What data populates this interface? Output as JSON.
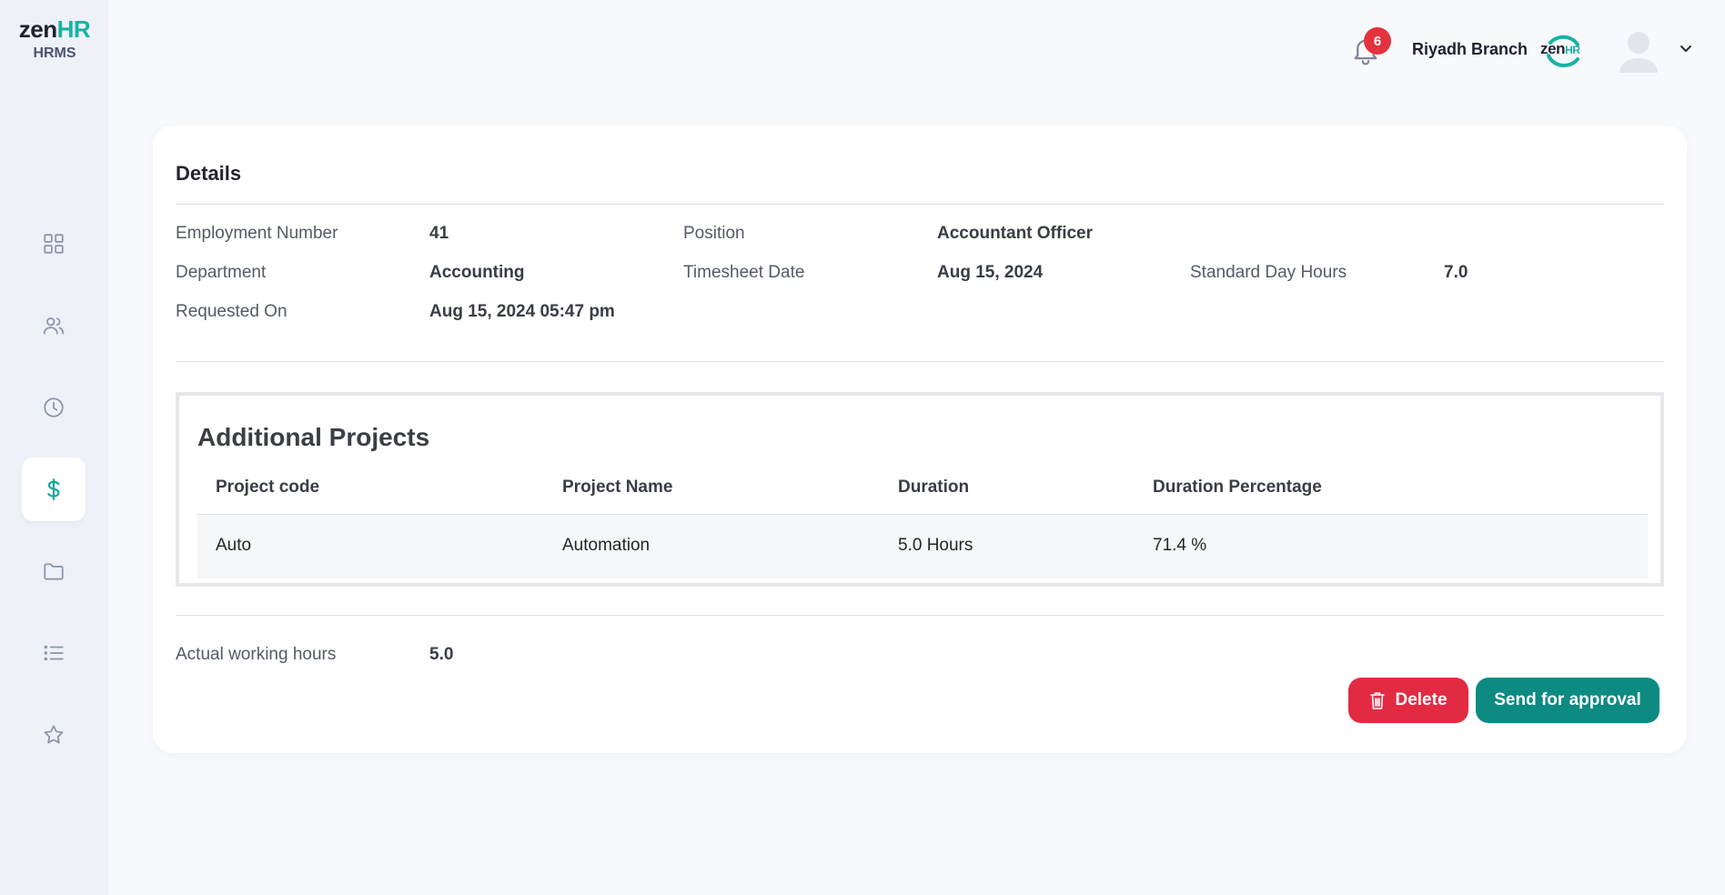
{
  "app": {
    "logo_text": "zen",
    "logo_hr": "HR",
    "logo_sub": "HRMS"
  },
  "sidebar": {
    "items": [
      {
        "icon": "grid-icon",
        "active": false
      },
      {
        "icon": "users-icon",
        "active": false
      },
      {
        "icon": "clock-icon",
        "active": false
      },
      {
        "icon": "dollar-icon",
        "active": true
      },
      {
        "icon": "folder-icon",
        "active": false
      },
      {
        "icon": "list-icon",
        "active": false
      },
      {
        "icon": "star-icon",
        "active": false
      }
    ]
  },
  "header": {
    "notification_count": "6",
    "branch_name": "Riyadh Branch",
    "company_logo_text": "zen",
    "company_logo_hr": "HR"
  },
  "details": {
    "title": "Details",
    "employment_number_label": "Employment Number",
    "employment_number_value": "41",
    "position_label": "Position",
    "position_value": "Accountant Officer",
    "department_label": "Department",
    "department_value": "Accounting",
    "timesheet_date_label": "Timesheet Date",
    "timesheet_date_value": "Aug 15, 2024",
    "standard_day_hours_label": "Standard Day Hours",
    "standard_day_hours_value": "7.0",
    "requested_on_label": "Requested On",
    "requested_on_value": "Aug 15, 2024 05:47 pm"
  },
  "projects": {
    "title": "Additional Projects",
    "columns": [
      "Project code",
      "Project Name",
      "Duration",
      "Duration Percentage"
    ],
    "rows": [
      [
        "Auto",
        "Automation",
        "5.0 Hours",
        "71.4 %"
      ]
    ]
  },
  "summary": {
    "actual_hours_label": "Actual working hours",
    "actual_hours_value": "5.0"
  },
  "actions": {
    "delete_label": "Delete",
    "send_label": "Send for approval"
  },
  "colors": {
    "accent": "#0d8a82",
    "danger": "#e32a43",
    "brand_teal": "#1ab2a6"
  }
}
